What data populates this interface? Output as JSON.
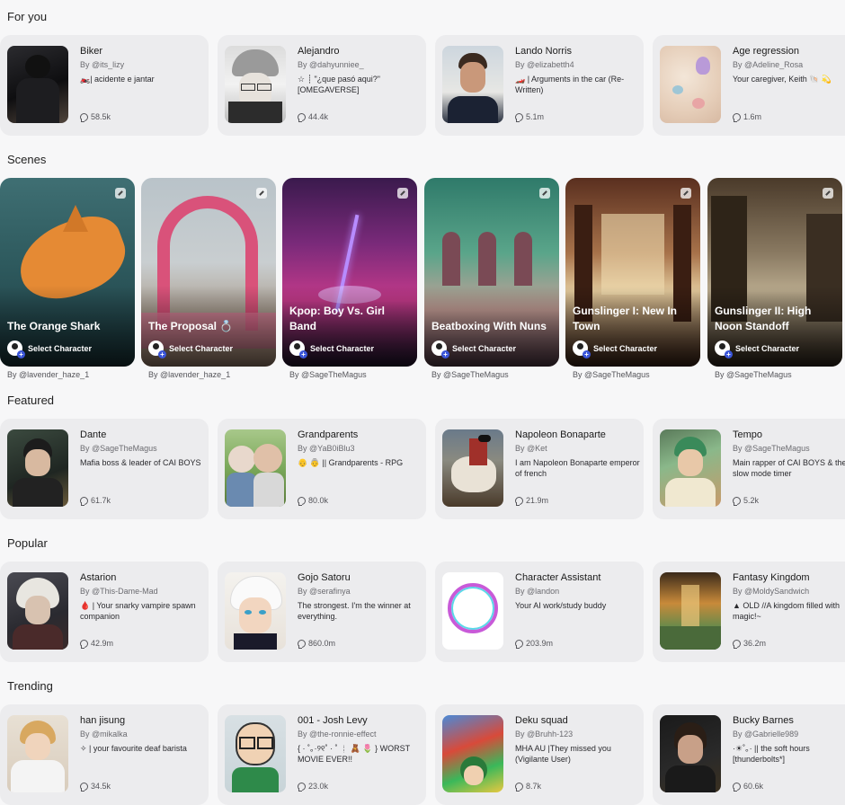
{
  "sections": {
    "for_you": "For you",
    "scenes": "Scenes",
    "featured": "Featured",
    "popular": "Popular",
    "trending": "Trending"
  },
  "for_you": [
    {
      "name": "Biker",
      "author": "By @its_lizy",
      "desc": "🏍️| acidente e jantar",
      "chats": "58.5k"
    },
    {
      "name": "Alejandro",
      "author": "By @dahyunniee_",
      "desc": "☆ ┊ \"¿que pasó aqui?\" [OMEGAVERSE]",
      "chats": "44.4k"
    },
    {
      "name": "Lando Norris",
      "author": "By @elizabetth4",
      "desc": "🏎️ | Arguments in the car (Re-Written)",
      "chats": "5.1m"
    },
    {
      "name": "Age regression",
      "author": "By @Adeline_Rosa",
      "desc": "Your caregiver, Keith 🐚 💫",
      "chats": "1.6m"
    }
  ],
  "scenes": [
    {
      "title": "The Orange Shark",
      "author": "By @lavender_haze_1"
    },
    {
      "title": "The Proposal 💍",
      "author": "By @lavender_haze_1"
    },
    {
      "title": "Kpop: Boy Vs. Girl Band",
      "author": "By @SageTheMagus"
    },
    {
      "title": "Beatboxing With Nuns",
      "author": "By @SageTheMagus"
    },
    {
      "title": "Gunslinger I: New In Town",
      "author": "By @SageTheMagus"
    },
    {
      "title": "Gunslinger II: High Noon Standoff",
      "author": "By @SageTheMagus"
    }
  ],
  "select_label": "Select Character",
  "featured": [
    {
      "name": "Dante",
      "author": "By @SageTheMagus",
      "desc": "Mafia boss & leader of CAI BOYS",
      "chats": "61.7k"
    },
    {
      "name": "Grandparents",
      "author": "By @YaB0iBlu3",
      "desc": "👴 👵 || Grandparents - RPG",
      "chats": "80.0k"
    },
    {
      "name": "Napoleon Bonaparte",
      "author": "By @Ket",
      "desc": "I am Napoleon Bonaparte emperor of french",
      "chats": "21.9m"
    },
    {
      "name": "Tempo",
      "author": "By @SageTheMagus",
      "desc": "Main rapper of CAI BOYS & the slow mode timer",
      "chats": "5.2k"
    }
  ],
  "popular": [
    {
      "name": "Astarion",
      "author": "By @This-Dame-Mad",
      "desc": "🩸 | Your snarky vampire spawn companion",
      "chats": "42.9m"
    },
    {
      "name": "Gojo Satoru",
      "author": "By @serafinya",
      "desc": "The strongest. I'm the winner at everything.",
      "chats": "860.0m"
    },
    {
      "name": "Character Assistant",
      "author": "By @landon",
      "desc": "Your AI work/study buddy",
      "chats": "203.9m"
    },
    {
      "name": "Fantasy Kingdom",
      "author": "By @MoldySandwich",
      "desc": "▲ OLD //A kingdom filled with magic!~",
      "chats": "36.2m"
    }
  ],
  "trending": [
    {
      "name": "han jisung",
      "author": "By @mikalka",
      "desc": "✧ | your favourite deaf barista",
      "chats": "34.5k"
    },
    {
      "name": "001 - Josh Levy",
      "author": "By @the-ronnie-effect",
      "desc": "{ · ˚｡·୨୧˚ · ˚ ┊ 🧸 🌷 } WORST MOVIE EVER!!",
      "chats": "23.0k"
    },
    {
      "name": "Deku squad",
      "author": "By @Bruhh-123",
      "desc": "MHA AU |They missed you (Vigilante User)",
      "chats": "8.7k"
    },
    {
      "name": "Bucky Barnes",
      "author": "By @Gabrielle989",
      "desc": "·☀︎˚｡· || the soft hours [thunderbolts*]",
      "chats": "60.6k"
    }
  ],
  "colors": {
    "background": "#f7f7f8",
    "card": "#ececee",
    "plus_badge": "#3a55d8"
  }
}
